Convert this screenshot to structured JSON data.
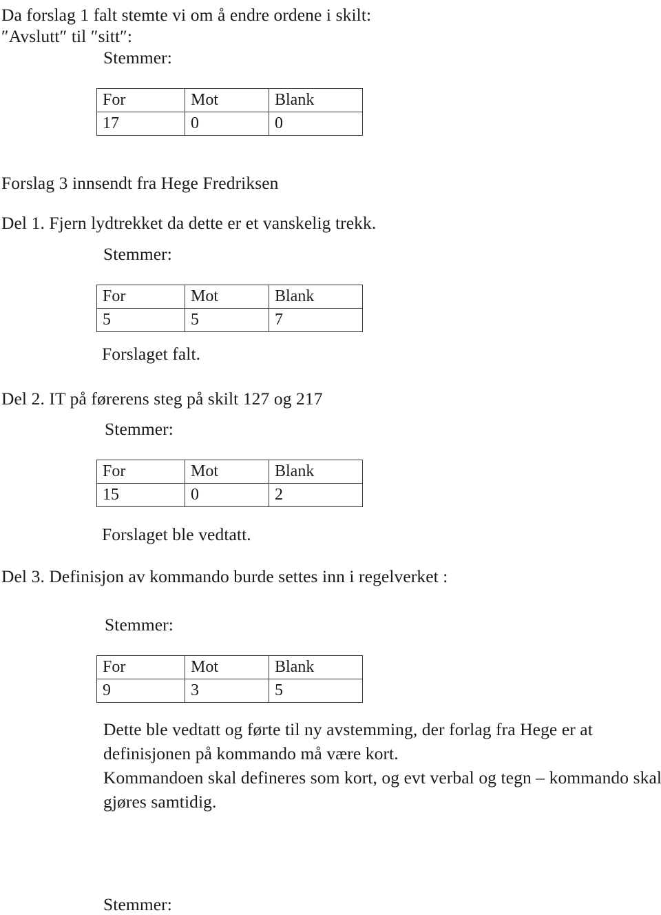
{
  "document": {
    "blocks": [
      {
        "id": "intro",
        "line1": "Da forslag 1 falt stemte vi om å endre ordene i skilt:",
        "line2": "″Avslutt″ til ″sitt″:",
        "stemmer_label": "Stemmer:"
      },
      {
        "id": "forslag3",
        "heading": "Forslag 3 innsendt fra Hege Fredriksen"
      },
      {
        "id": "del1",
        "heading": "Del 1.  Fjern lydtrekket da dette er et vanskelig trekk.",
        "stemmer_label": "Stemmer:",
        "result": "Forslaget falt."
      },
      {
        "id": "del2",
        "heading": "Del 2. IT på førerens steg på skilt 127 og 217",
        "stemmer_label": "Stemmer:",
        "result": "Forslaget ble vedtatt."
      },
      {
        "id": "del3",
        "heading": "Del 3. Definisjon av kommando burde settes inn i regelverket :",
        "stemmer_label": "Stemmer:",
        "paragraph_line1": "Dette ble vedtatt og førte til ny avstemming, der forlag fra Hege er at",
        "paragraph_line2": "definisjonen på kommando må være kort.",
        "paragraph_line3": "Kommandoen skal defineres som kort, og evt verbal og tegn – kommando skal",
        "paragraph_line4": "gjøres samtidig.",
        "stemmer_label_trailing": "Stemmer:"
      }
    ],
    "vote_tables": [
      {
        "id": "vote-table-1",
        "headers": [
          "For",
          "Mot",
          "Blank"
        ],
        "values": [
          "17",
          "0",
          "0"
        ]
      },
      {
        "id": "vote-table-2",
        "headers": [
          "For",
          "Mot",
          "Blank"
        ],
        "values": [
          "5",
          "5",
          "7"
        ]
      },
      {
        "id": "vote-table-3",
        "headers": [
          "For",
          "Mot",
          "Blank"
        ],
        "values": [
          "15",
          "0",
          "2"
        ]
      },
      {
        "id": "vote-table-4",
        "headers": [
          "For",
          "Mot",
          "Blank"
        ],
        "values": [
          "9",
          "3",
          "5"
        ]
      }
    ],
    "colors": {
      "text": "#1a1a1a",
      "table_border": "#3a3a3a",
      "background": "#ffffff"
    }
  }
}
